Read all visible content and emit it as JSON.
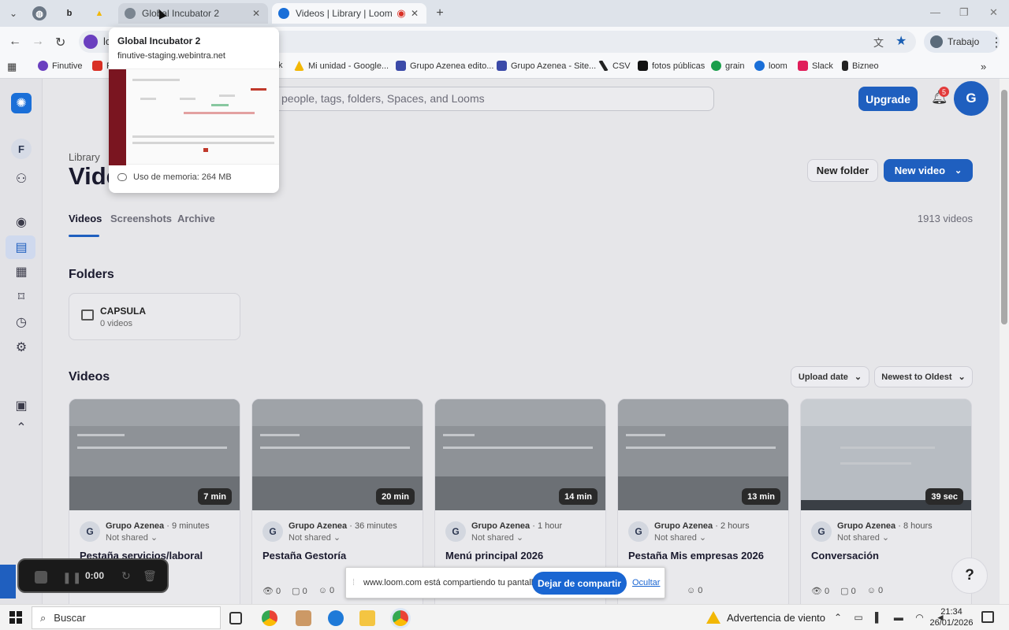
{
  "browser": {
    "tabs": [
      {
        "title": "Global Incubator 2",
        "state": "hover"
      },
      {
        "title": "Videos | Library | Loom",
        "state": "active"
      }
    ],
    "profile_label": "Trabajo",
    "bookmarks": [
      "Finutive",
      "R",
      "k",
      "Mi unidad - Google...",
      "Grupo Azenea edito...",
      "Grupo Azenea - Site...",
      "CSV",
      "fotos públicas",
      "grain",
      "loom",
      "Slack",
      "Bizneo"
    ],
    "omnibox_partial": "lo"
  },
  "hover_card": {
    "title": "Global Incubator 2",
    "url": "finutive-staging.webintra.net",
    "memory": "Uso de memoria: 264 MB"
  },
  "loom": {
    "workspace_initial": "F",
    "search_placeholder": "people, tags, folders, Spaces, and Looms",
    "upgrade_label": "Upgrade",
    "notifications_count": "5",
    "avatar_initial": "G",
    "breadcrumb": "Library",
    "page_title": "Vide",
    "new_folder_label": "New folder",
    "new_video_label": "New video",
    "tabs": [
      "Videos",
      "Screenshots",
      "Archive"
    ],
    "video_count": "1913 videos",
    "folders_heading": "Folders",
    "folder": {
      "name": "CAPSULA",
      "count": "0 videos"
    },
    "videos_heading": "Videos",
    "sort_primary": "Upload date",
    "sort_order": "Newest to Oldest",
    "videos": [
      {
        "title": "Pestaña servicios/laboral",
        "owner": "Grupo Azenea",
        "age": "9 minutes",
        "sharing": "Not shared",
        "duration": "7 min",
        "views": "",
        "comments": "",
        "reactions": ""
      },
      {
        "title": "Pestaña Gestoría",
        "owner": "Grupo Azenea",
        "age": "36 minutes",
        "sharing": "Not shared",
        "duration": "20 min",
        "views": "0",
        "comments": "0",
        "reactions": "0"
      },
      {
        "title": "Menú principal 2026",
        "owner": "Grupo Azenea",
        "age": "1 hour",
        "sharing": "Not shared",
        "duration": "14 min",
        "views": "",
        "comments": "",
        "reactions": ""
      },
      {
        "title": "Pestaña Mis empresas 2026",
        "owner": "Grupo Azenea",
        "age": "2 hours",
        "sharing": "Not shared",
        "duration": "13 min",
        "views": "",
        "comments": "",
        "reactions": "0"
      },
      {
        "title": "Conversación",
        "owner": "Grupo Azenea",
        "age": "8 hours",
        "sharing": "Not shared",
        "duration": "39 sec",
        "views": "0",
        "comments": "0",
        "reactions": "0"
      }
    ],
    "help_label": "?"
  },
  "recorder": {
    "time": "0:00"
  },
  "sharebar": {
    "message": "www.loom.com está compartiendo tu pantalla.",
    "stop_label": "Dejar de compartir",
    "hide_label": "Ocultar"
  },
  "taskbar": {
    "search_label": "Buscar",
    "weather": "Advertencia de viento",
    "time": "21:34",
    "date": "26/01/2026"
  },
  "colors": {
    "accent": "#1f5fbf",
    "loom_bg": "#e6e6e9",
    "brand_red": "#7a1520"
  }
}
